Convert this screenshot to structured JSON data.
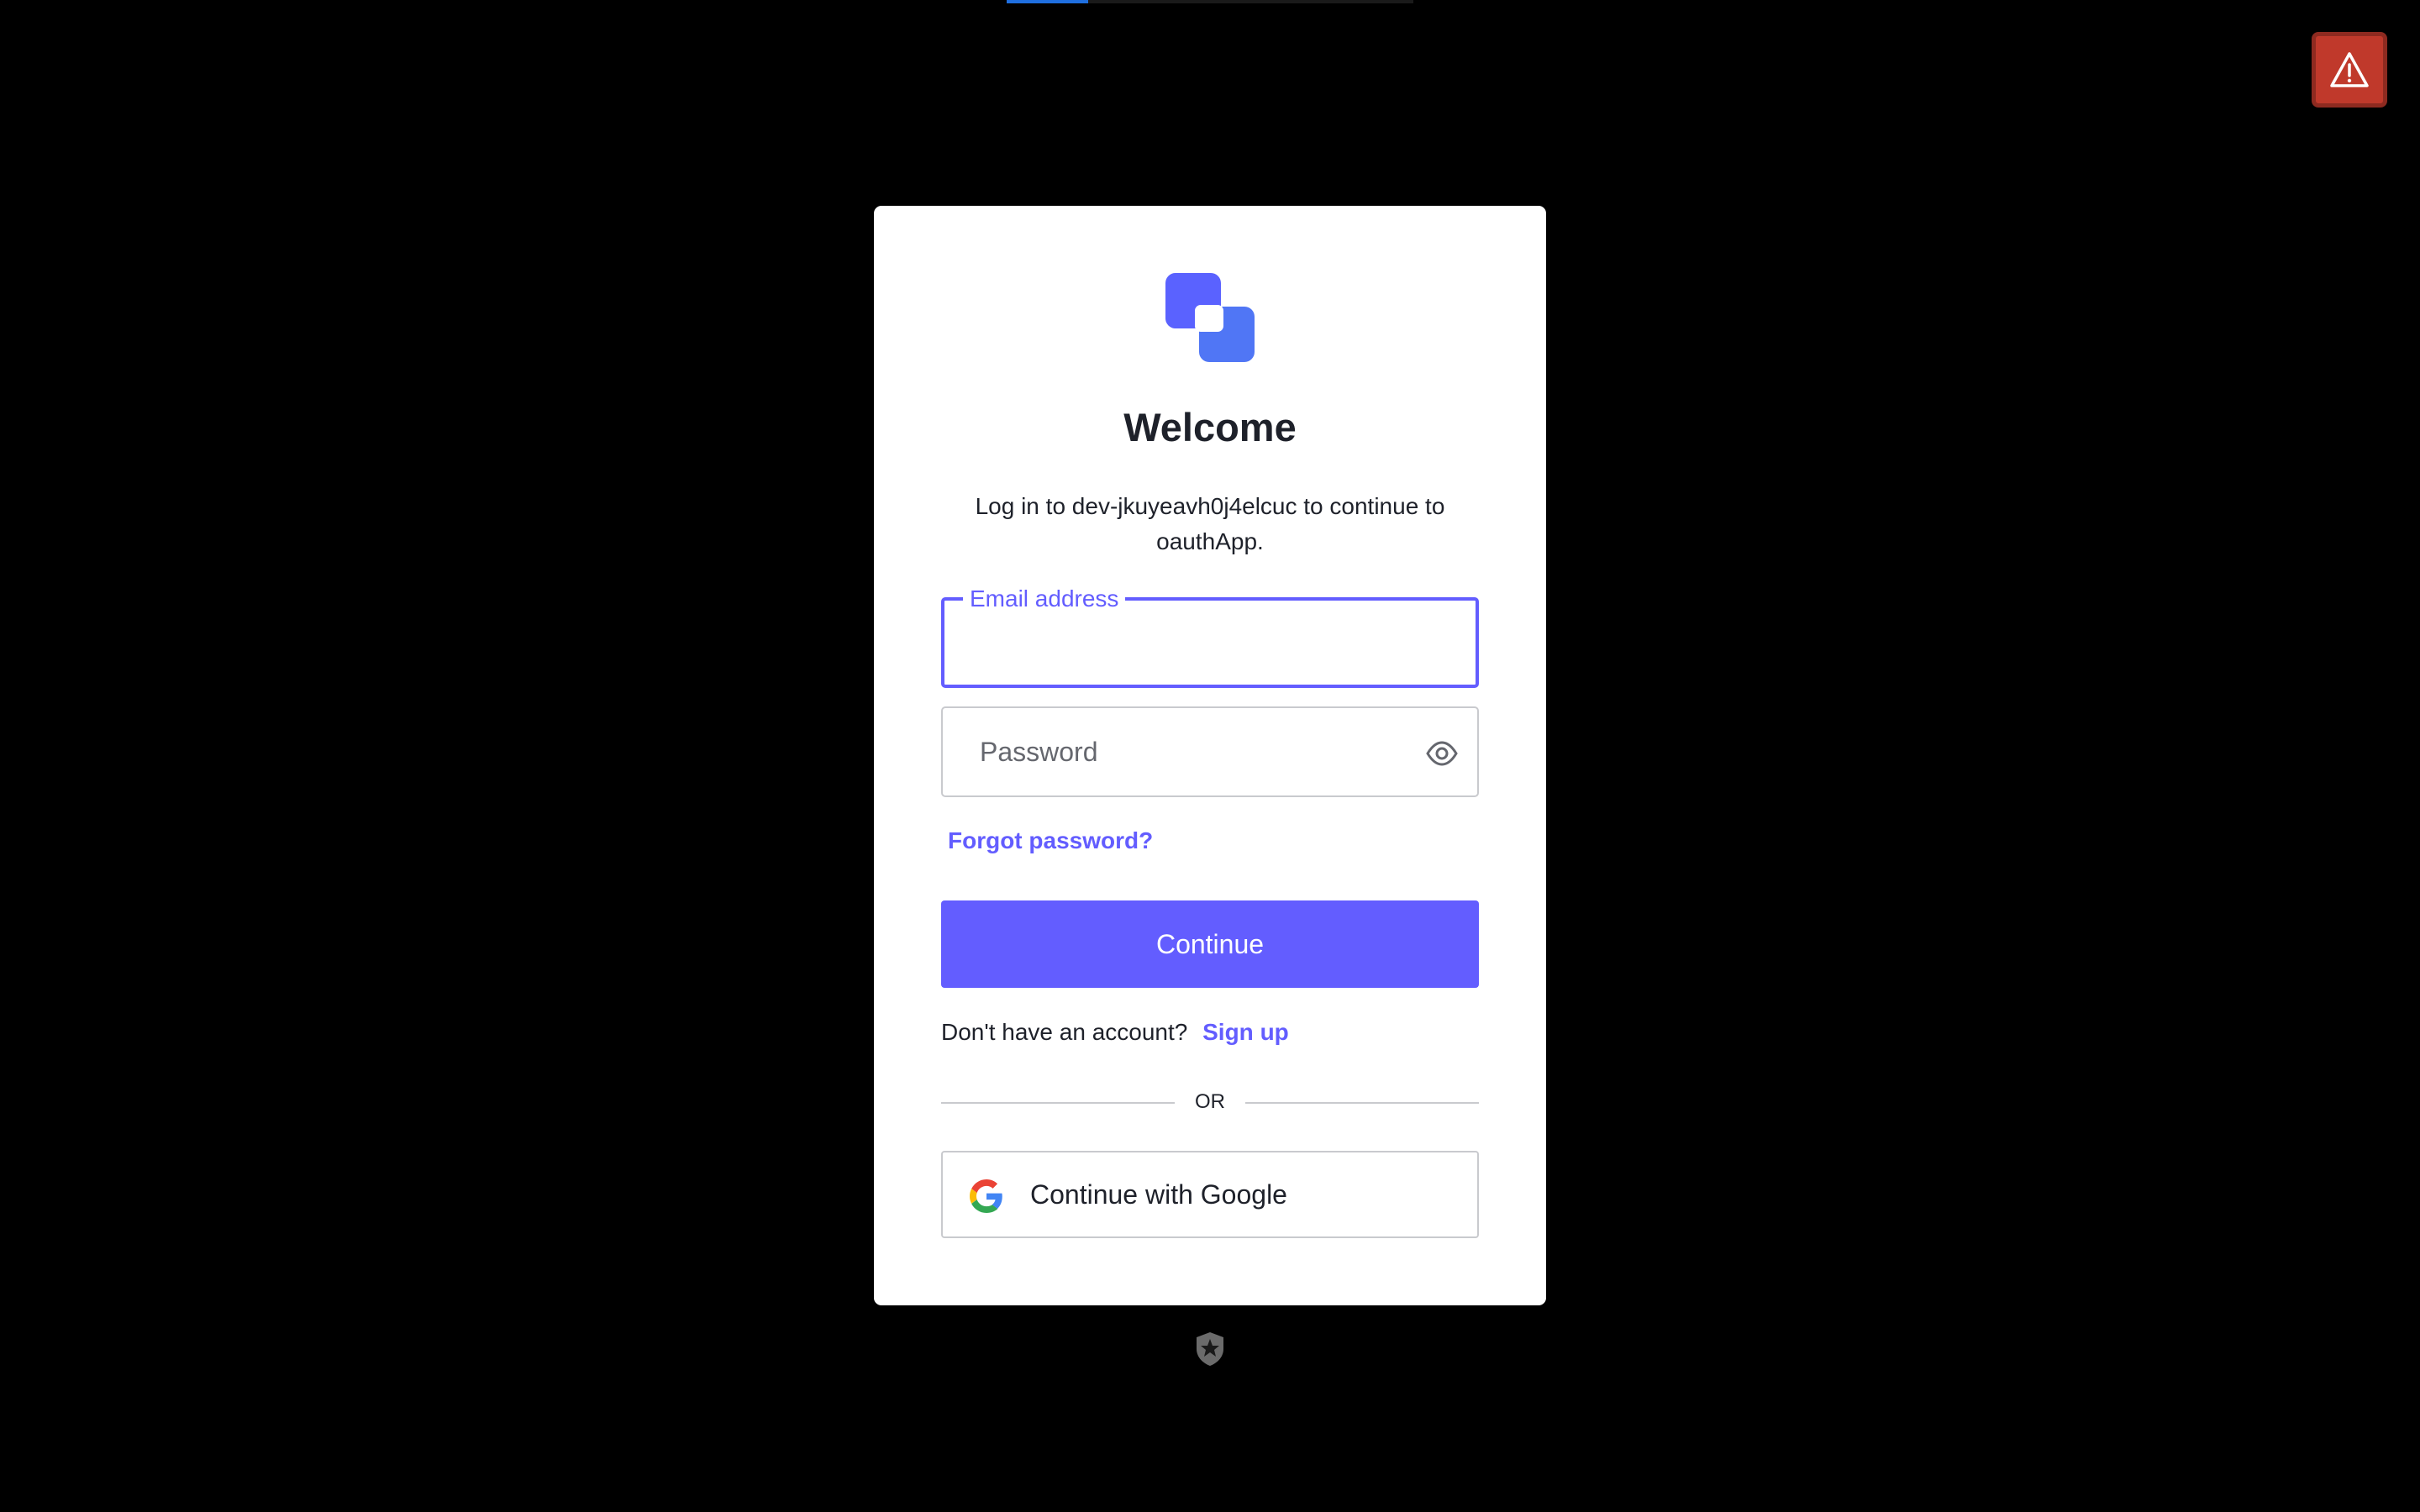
{
  "progress": {
    "fraction": 0.2
  },
  "warning": {
    "icon": "warning-triangle-icon",
    "color": "#c0392b"
  },
  "brand": {
    "logo_icon": "overlapping-squares-logo-icon",
    "accent": "#635dff"
  },
  "login": {
    "title": "Welcome",
    "subtitle": "Log in to dev-jkuyeavh0j4elcuc to continue to oauthApp.",
    "email_label": "Email address",
    "email_value": "",
    "password_placeholder": "Password",
    "password_toggle_icon": "eye-icon",
    "forgot_password": "Forgot password?",
    "continue_label": "Continue",
    "no_account_text": "Don't have an account?",
    "signup_label": "Sign up",
    "divider_text": "OR",
    "google_label": "Continue with Google",
    "google_icon": "google-g-icon"
  },
  "footer": {
    "badge_icon": "auth0-shield-icon"
  }
}
